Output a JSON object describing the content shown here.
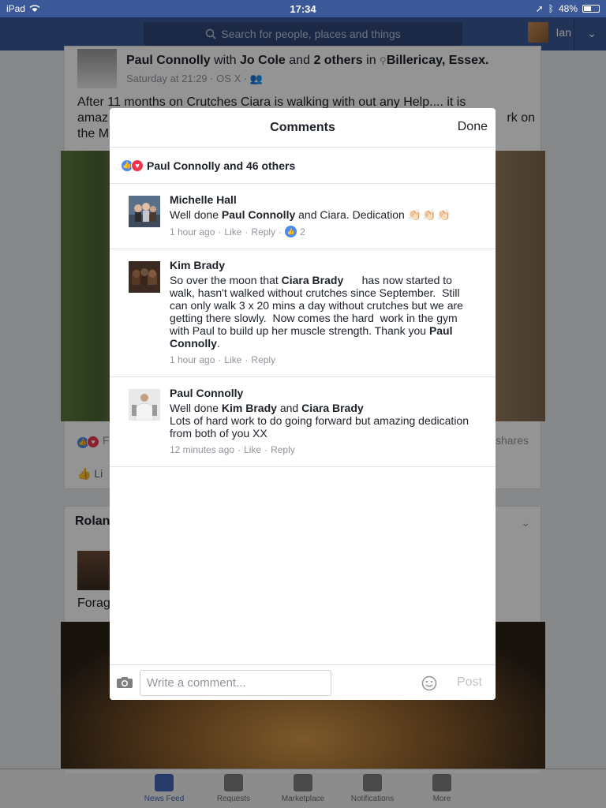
{
  "status_bar": {
    "device": "iPad",
    "time": "17:34",
    "battery": "48%",
    "battery_level": 0.48
  },
  "nav": {
    "search_placeholder": "Search for people, places and things",
    "user_name": "Ian"
  },
  "background_post": {
    "author": "Paul Connolly",
    "with_text": "with",
    "tagged_1": "Jo Cole",
    "and_text": "and",
    "tagged_others": "2 others",
    "in_text": "in",
    "location": "Billericay, Essex.",
    "meta": "Saturday at 21:29 · OS X ·",
    "text_line1": "After 11 months on Crutches  Ciara is walking with out any Help.... it is",
    "text_line2_left": "amaz",
    "text_line2_right": "rk on",
    "text_line3_left": "the M",
    "reactions_partial": "F",
    "shares_partial": "shares",
    "like_partial": "Li"
  },
  "background_post2": {
    "author_partial": "Rolan",
    "text_partial": "Forag"
  },
  "modal": {
    "title": "Comments",
    "done_label": "Done",
    "reactions_summary": "Paul Connolly and 46 others",
    "comments": [
      {
        "author": "Michelle Hall",
        "segments": [
          "Well done ",
          "Paul Connolly",
          " and Ciara. Dedication "
        ],
        "claps": "👏🏻👏🏻👏🏻",
        "time": "1 hour ago",
        "like_label": "Like",
        "reply_label": "Reply",
        "like_count": "2"
      },
      {
        "author": "Kim Brady",
        "segments": [
          "So over the moon that ",
          "Ciara Brady",
          "      has now started to walk, hasn't walked without crutches since September.  Still can only walk 3 x 20 mins a day without crutches but we are getting there slowly.  Now comes the hard  work in the gym with Paul to build up her muscle strength. Thank you ",
          "Paul Connolly",
          "."
        ],
        "time": "1 hour ago",
        "like_label": "Like",
        "reply_label": "Reply"
      },
      {
        "author": "Paul Connolly",
        "segments": [
          "Well done ",
          "Kim Brady",
          " and ",
          "Ciara Brady"
        ],
        "line2": "Lots of hard work to do going forward but amazing dedication from both of you XX",
        "time": "12 minutes ago",
        "like_label": "Like",
        "reply_label": "Reply"
      }
    ],
    "composer": {
      "placeholder": "Write a comment...",
      "post_label": "Post"
    }
  },
  "tab_bar": {
    "tabs": [
      {
        "label": "News Feed",
        "icon": "news-feed-icon",
        "active": true
      },
      {
        "label": "Requests",
        "icon": "friend-requests-icon",
        "active": false
      },
      {
        "label": "Marketplace",
        "icon": "marketplace-icon",
        "active": false
      },
      {
        "label": "Notifications",
        "icon": "globe-icon",
        "active": false
      },
      {
        "label": "More",
        "icon": "hamburger-icon",
        "active": false
      }
    ]
  },
  "colors": {
    "brand": "#3b5998",
    "like_blue": "#4a8af4",
    "love_red": "#f0364f",
    "tab_active": "#4267b2"
  }
}
